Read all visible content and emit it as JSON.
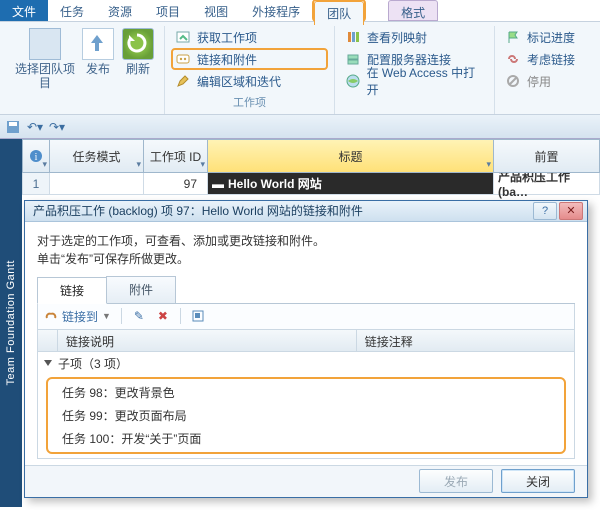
{
  "menu": {
    "file": "文件",
    "tabs": [
      "任务",
      "资源",
      "项目",
      "视图",
      "外接程序",
      "团队",
      "格式"
    ],
    "highlight_index": 5
  },
  "ribbon": {
    "group1": {
      "select_team_project": "选择团队项目",
      "publish": "发布",
      "refresh": "刷新"
    },
    "group2": {
      "get_work_items": "获取工作项",
      "links_attach": "链接和附件",
      "edit_area_iter": "编辑区域和迭代",
      "title": "工作项"
    },
    "group3": {
      "col_map": "查看列映射",
      "config_server": "配置服务器连接",
      "open_web": "在 Web Access 中打开"
    },
    "group4": {
      "mark_progress": "标记进度",
      "ref_links": "考虑链接",
      "disable": "停用"
    }
  },
  "grid": {
    "sidebar": "Team Foundation Gantt",
    "headers": {
      "task_mode": "任务模式",
      "work_item_id": "工作项 ID",
      "title": "标题",
      "pred": "前置"
    },
    "row1": {
      "num": "1",
      "id": "97",
      "title": "Hello World 网站",
      "pred": "产品积压工作 (ba…"
    }
  },
  "dialog": {
    "title": "产品积压工作 (backlog) 项 97：Hello World 网站的链接和附件",
    "hint1": "对于选定的工作项，可查看、添加或更改链接和附件。",
    "hint2": "单击“发布”可保存所做更改。",
    "tabs": {
      "links": "链接",
      "attach": "附件"
    },
    "toolbar": {
      "link_to": "链接到"
    },
    "list": {
      "col_desc": "链接说明",
      "col_note": "链接注释",
      "group": "子项（3 项）",
      "items": [
        "任务 98：更改背景色",
        "任务 99：更改页面布局",
        "任务 100：开发“关于”页面"
      ]
    },
    "buttons": {
      "publish": "发布",
      "close": "关闭"
    }
  }
}
